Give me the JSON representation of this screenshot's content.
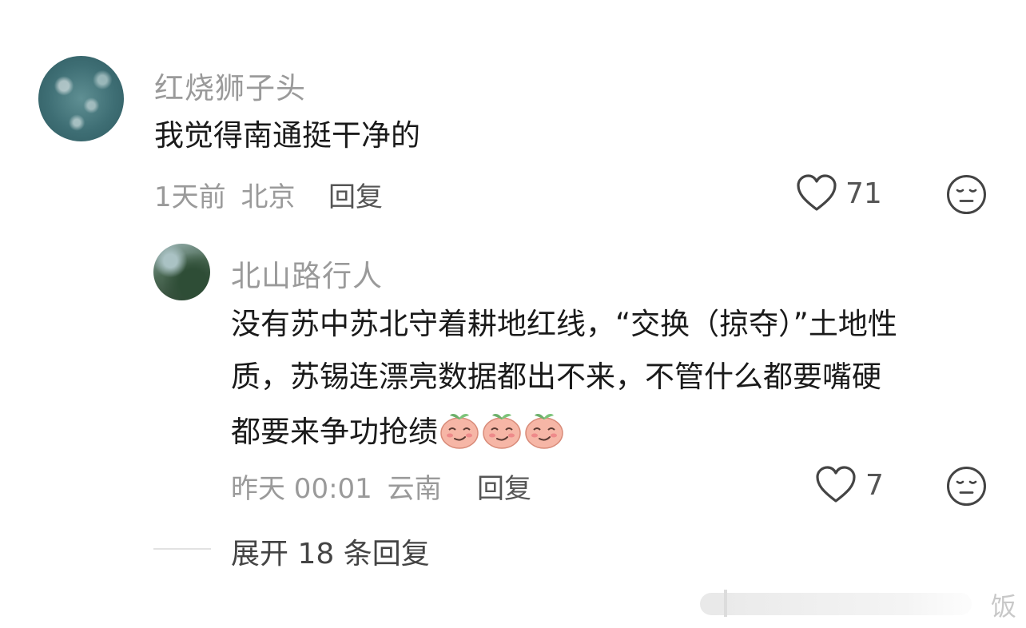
{
  "comments": [
    {
      "username": "红烧狮子头",
      "text": "我觉得南通挺干净的",
      "time": "1天前",
      "location": "北京",
      "reply_label": "回复",
      "likes": "71",
      "icons": [
        "heart-outline-icon",
        "meh-face-icon"
      ]
    }
  ],
  "reply": {
    "username": "北山路行人",
    "text_lines": [
      "没有苏中苏北守着耕地红线，“交换（掠夺）”土地性",
      "质，苏锡连漂亮数据都出不来，不管什么都要嘴硬",
      "都要来争功抢绩"
    ],
    "emojis": [
      "smug-peach-emoji",
      "smug-peach-emoji",
      "smug-peach-emoji"
    ],
    "time": "昨天 00:01",
    "location": "云南",
    "reply_label": "回复",
    "likes": "7"
  },
  "expand": {
    "label": "展开 18 条回复"
  },
  "watermark": {
    "text": "饭"
  },
  "colors": {
    "muted_text": "#9a9a9a",
    "body_text": "#1a1a1a",
    "action_text": "#555555",
    "icon_stroke": "#444444"
  }
}
